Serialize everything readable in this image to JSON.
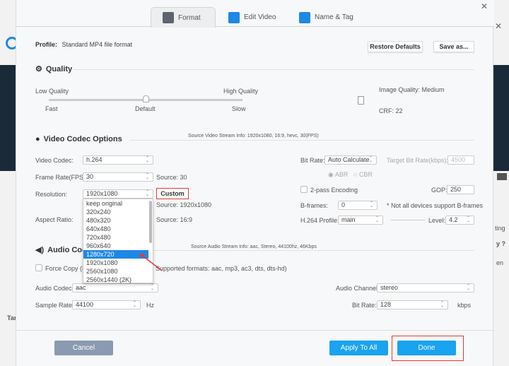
{
  "tabs": [
    {
      "label": "Format",
      "icon": "format-icon"
    },
    {
      "label": "Edit Video",
      "icon": "edit-video-icon"
    },
    {
      "label": "Name & Tag",
      "icon": "name-tag-icon"
    }
  ],
  "profile": {
    "label": "Profile:",
    "value": "Standard MP4 file format"
  },
  "buttons": {
    "restore": "Restore Defaults",
    "save_as": "Save as...",
    "custom": "Custom",
    "cancel": "Cancel",
    "apply_all": "Apply To All",
    "done": "Done"
  },
  "quality": {
    "title": "Quality",
    "low": "Low Quality",
    "high": "High Quality",
    "fast": "Fast",
    "default": "Default",
    "slow": "Slow",
    "slider_value": 0.5,
    "image_quality": "Image Quality: Medium",
    "crf": "CRF: 22"
  },
  "video": {
    "title": "Video Codec Options",
    "source_info": "Source Video Stream Info: 1920x1080, 16:9, hevc, 30(FPS)",
    "codec_label": "Video Codec:",
    "codec": "h.264",
    "fps_label": "Frame Rate(FPS):",
    "fps": "30",
    "fps_source": "Source: 30",
    "res_label": "Resolution:",
    "res": "1920x1080",
    "res_source": "Source: 1920x1080",
    "aspect_label": "Aspect Ratio:",
    "aspect_source": "Source: 16:9",
    "res_options": [
      "keep original",
      "320x240",
      "480x320",
      "640x480",
      "720x480",
      "960x640",
      "1280x720",
      "1920x1080",
      "2560x1080",
      "2560x1440 (2K)"
    ],
    "res_highlight": "1280x720",
    "bitrate_label": "Bit Rate:",
    "bitrate": "Auto Calculate",
    "target_label": "Target Bit Rate(kbps):",
    "target": "4500",
    "abr": "ABR",
    "cbr": "CBR",
    "twopass": "2-pass Encoding",
    "gop_label": "GOP:",
    "gop": "250",
    "bframes_label": "B-frames:",
    "bframes": "0",
    "bframes_note": "* Not all devices support B-frames",
    "profile_label": "H.264 Profile:",
    "profile": "main",
    "level_label": "Level:",
    "level": "4.2"
  },
  "audio": {
    "title": "Audio Codec",
    "source_info": "Source Audio Stream Info: aac, Stereo, 44100hz, 46Kbps",
    "force_copy": "Force Copy (P",
    "supported": "Supported formats: aac, mp3, ac3, dts, dts-hd)",
    "codec_label": "Audio Codec:",
    "codec": "aac",
    "channel_label": "Audio Channel:",
    "channel": "stereo",
    "sample_label": "Sample Rate:",
    "sample": "44100",
    "hz": "Hz",
    "bitrate_label": "Bit Rate:",
    "bitrate": "128",
    "kbps": "kbps"
  },
  "background": {
    "partial_text_1": "ting",
    "partial_text_2": "y ?",
    "partial_text_3": "en",
    "partial_text_4": "Tar"
  }
}
